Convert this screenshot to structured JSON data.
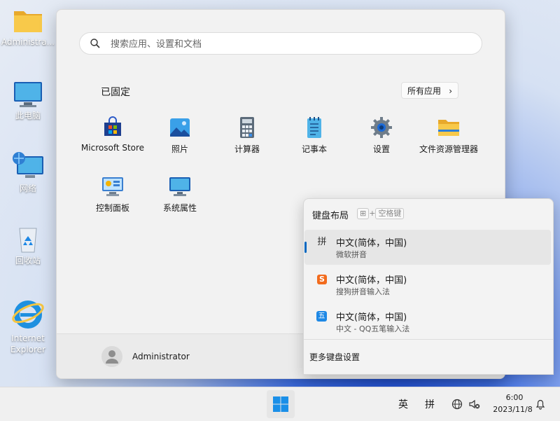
{
  "desktop": {
    "icons": [
      {
        "label": "Administra..."
      },
      {
        "label": "此电脑"
      },
      {
        "label": "网络"
      },
      {
        "label": "回收站"
      },
      {
        "label": "Internet Explorer"
      }
    ]
  },
  "start_menu": {
    "search": {
      "placeholder": "搜索应用、设置和文档"
    },
    "pinned_title": "已固定",
    "all_apps_label": "所有应用",
    "apps": [
      {
        "label": "Microsoft Store",
        "icon": "store-icon"
      },
      {
        "label": "照片",
        "icon": "photos-icon"
      },
      {
        "label": "计算器",
        "icon": "calculator-icon"
      },
      {
        "label": "记事本",
        "icon": "notepad-icon"
      },
      {
        "label": "设置",
        "icon": "gear-icon"
      },
      {
        "label": "文件资源管理器",
        "icon": "folder-icon"
      },
      {
        "label": "控制面板",
        "icon": "control-panel-icon"
      },
      {
        "label": "系统属性",
        "icon": "monitor-icon"
      }
    ],
    "user": {
      "name": "Administrator"
    }
  },
  "keyboard_flyout": {
    "title": "键盘布局",
    "shortcut_plus": "+",
    "shortcut_key": "空格键",
    "items": [
      {
        "icon_text": "拼",
        "name": "中文(简体，中国)",
        "sub": "微软拼音",
        "selected": true
      },
      {
        "icon_text": "S",
        "name": "中文(简体，中国)",
        "sub": "搜狗拼音输入法",
        "selected": false
      },
      {
        "icon_text": "五",
        "name": "中文(简体，中国)",
        "sub": "中文 - QQ五笔输入法",
        "selected": false
      }
    ],
    "more_settings": "更多键盘设置"
  },
  "taskbar": {
    "ime_lang": "英",
    "ime_mode": "拼",
    "time": "6:00",
    "date": "2023/11/8"
  },
  "colors": {
    "accent": "#0067c0",
    "sogou_orange": "#f26b1d",
    "qq_blue": "#1e88e5"
  }
}
